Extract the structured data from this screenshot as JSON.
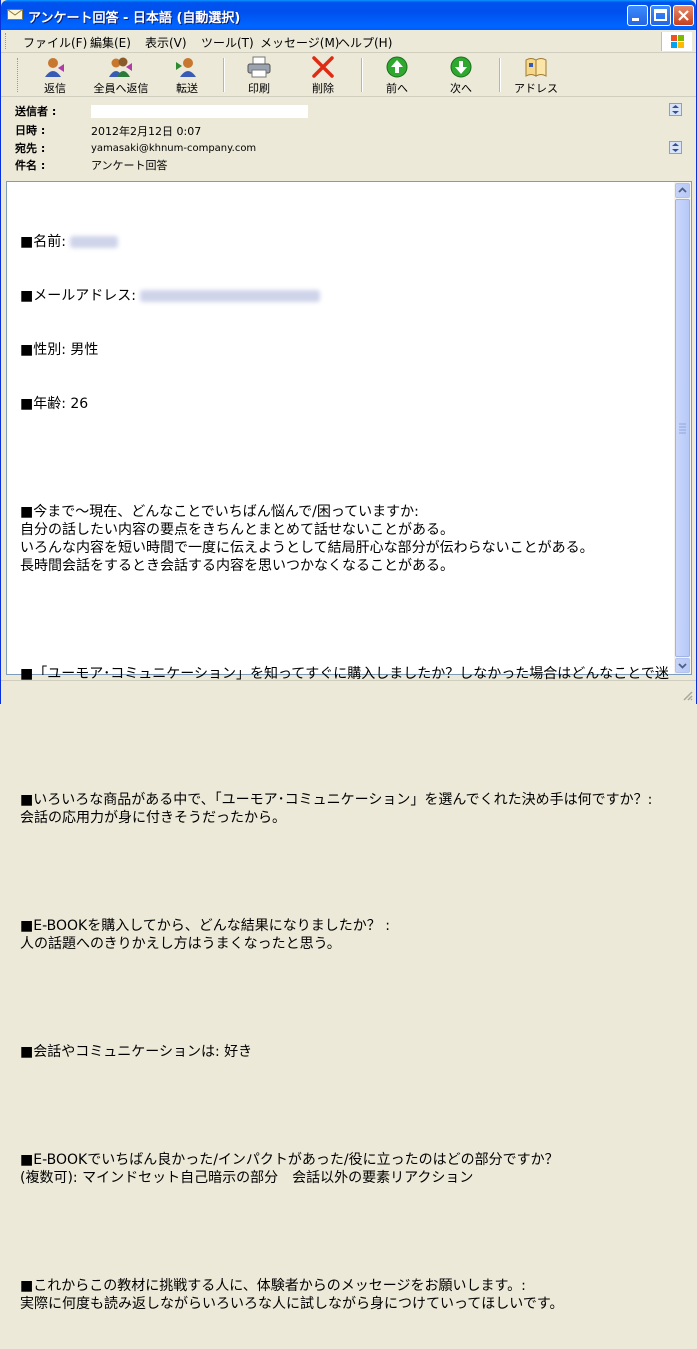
{
  "window": {
    "title": "アンケート回答 - 日本語 (自動選択)"
  },
  "menu": [
    {
      "label": "ファイル(F)"
    },
    {
      "label": "編集(E)"
    },
    {
      "label": "表示(V)"
    },
    {
      "label": "ツール(T)"
    },
    {
      "label": "メッセージ(M)"
    },
    {
      "label": "ヘルプ(H)"
    }
  ],
  "toolbar": {
    "reply": "返信",
    "reply_all": "全員へ返信",
    "forward": "転送",
    "print": "印刷",
    "delete": "削除",
    "previous": "前へ",
    "next": "次へ",
    "addresses": "アドレス"
  },
  "headers": {
    "from_label": "送信者 :",
    "date_label": "日時 :",
    "date_value": "2012年2月12日 0:07",
    "to_label": "宛先 :",
    "to_value": "yamasaki@khnum-company.com",
    "subject_label": "件名 :",
    "subject_value": "アンケート回答"
  },
  "body": {
    "name_label": "■名前: ",
    "email_label": "■メールアドレス: ",
    "gender": "■性別: 男性",
    "age": "■年齢: 26",
    "q1": "■今まで～現在、どんなことでいちばん悩んで/困っていますか:\n自分の話したい内容の要点をきちんとまとめて話せないことがある。\nいろんな内容を短い時間で一度に伝えようとして結局肝心な部分が伝わらないことがある。\n長時間会話をするとき会話する内容を思いつかなくなることがある。",
    "q2": "■「ユーモア･コミュニケーション」を知ってすぐに購入しましたか？しなかった場合はどんなことで迷ったり不安になりましたか？: すぐに購入した。",
    "q3": "■いろいろな商品がある中で、「ユーモア･コミュニケーション」を選んでくれた決め手は何ですか？: 会話の応用力が身に付きそうだったから。",
    "q4": "■E-BOOKを購入してから、どんな結果になりましたか？ :\n人の話題へのきりかえし方はうまくなったと思う。",
    "q5": "■会話やコミュニケーションは: 好き",
    "q6": "■E-BOOKでいちばん良かった/インパクトがあった/役に立ったのはどの部分ですか？\n(複数可): マインドセット自己暗示の部分　会話以外の要素リアクション",
    "q7": "■これからこの教材に挑戦する人に、体験者からのメッセージをお願いします。:\n実際に何度も読み返しながらいろいろな人に試しながら身につけていってほしいです。"
  }
}
